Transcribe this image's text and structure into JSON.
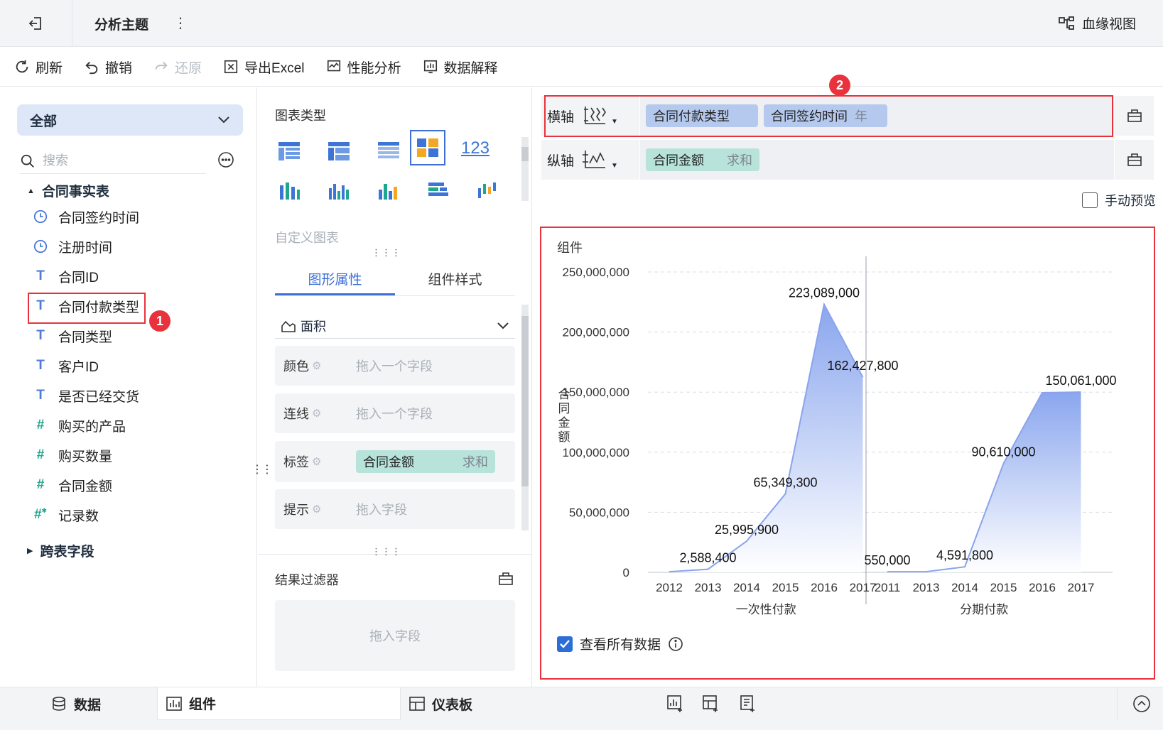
{
  "title_bar": {
    "title": "分析主题",
    "more": "⋮",
    "lineage_label": "血缘视图"
  },
  "toolbar": [
    {
      "label": "刷新",
      "icon": "refresh-icon",
      "enabled": true
    },
    {
      "label": "撤销",
      "icon": "undo-icon",
      "enabled": true
    },
    {
      "label": "还原",
      "icon": "redo-icon",
      "enabled": false
    },
    {
      "label": "导出Excel",
      "icon": "excel-icon",
      "enabled": true
    },
    {
      "label": "性能分析",
      "icon": "performance-icon",
      "enabled": true
    },
    {
      "label": "数据解释",
      "icon": "data-explain-icon",
      "enabled": true
    }
  ],
  "left": {
    "scope": "全部",
    "search_placeholder": "搜索",
    "group": "合同事实表",
    "fields": [
      {
        "name": "合同签约时间",
        "type": "date"
      },
      {
        "name": "注册时间",
        "type": "date"
      },
      {
        "name": "合同ID",
        "type": "text"
      },
      {
        "name": "合同付款类型",
        "type": "text"
      },
      {
        "name": "合同类型",
        "type": "text"
      },
      {
        "name": "客户ID",
        "type": "text"
      },
      {
        "name": "是否已经交货",
        "type": "text"
      },
      {
        "name": "购买的产品",
        "type": "number"
      },
      {
        "name": "购买数量",
        "type": "number"
      },
      {
        "name": "合同金额",
        "type": "number"
      },
      {
        "name": "记录数",
        "type": "count"
      }
    ],
    "cross_table": "跨表字段"
  },
  "middle": {
    "chart_type_title": "图表类型",
    "custom_chart": "自定义图表",
    "tabs": [
      "图形属性",
      "组件样式"
    ],
    "shape": "面积",
    "props": {
      "color_label": "颜色",
      "color_drop": "拖入一个字段",
      "line_label": "连线",
      "line_drop": "拖入一个字段",
      "label_label": "标签",
      "label_chip": "合同金额",
      "label_agg": "求和",
      "tip_label": "提示",
      "tip_drop": "拖入字段"
    },
    "filter_title": "结果过滤器",
    "filter_drop": "拖入字段"
  },
  "right": {
    "x_axis_label": "横轴",
    "x_fields": [
      {
        "name": "合同付款类型",
        "agg": ""
      },
      {
        "name": "合同签约时间",
        "agg": "年"
      }
    ],
    "y_axis_label": "纵轴",
    "y_fields": [
      {
        "name": "合同金额",
        "agg": "求和"
      }
    ],
    "manual_preview": "手动预览",
    "widget_title": "组件",
    "view_all": "查看所有数据"
  },
  "annotations": {
    "badge1": "1",
    "badge2": "2"
  },
  "bottom": {
    "data_tab": "数据",
    "widget_tab": "组件",
    "dashboard_tab": "仪表板"
  },
  "chart_data": {
    "type": "area",
    "ylabel": "合同金额",
    "ylim": [
      0,
      250000000
    ],
    "y_ticks": [
      "0",
      "50,000,000",
      "100,000,000",
      "150,000,000",
      "200,000,000",
      "250,000,000"
    ],
    "grid": true,
    "groups": [
      {
        "name": "一次性付款",
        "x": [
          "2012",
          "2013",
          "2014",
          "2015",
          "2016",
          "2017"
        ],
        "values": [
          500000,
          2588400,
          25995900,
          65349300,
          223089000,
          162427800
        ],
        "labels": [
          "",
          "2,588,400",
          "25,995,900",
          "65,349,300",
          "223,089,000",
          "162,427,800"
        ]
      },
      {
        "name": "分期付款",
        "x": [
          "2011",
          "2013",
          "2014",
          "2015",
          "2016",
          "2017"
        ],
        "values": [
          550000,
          550000,
          4591800,
          90610000,
          149500000,
          150061000
        ],
        "labels": [
          "550,000",
          "",
          "4,591,800",
          "90,610,000",
          "",
          "150,061,000"
        ]
      }
    ],
    "colors": {
      "fill_top": "#8aa6ee",
      "fill_bottom": "#ffffff",
      "line": "#8aa3ec"
    }
  }
}
